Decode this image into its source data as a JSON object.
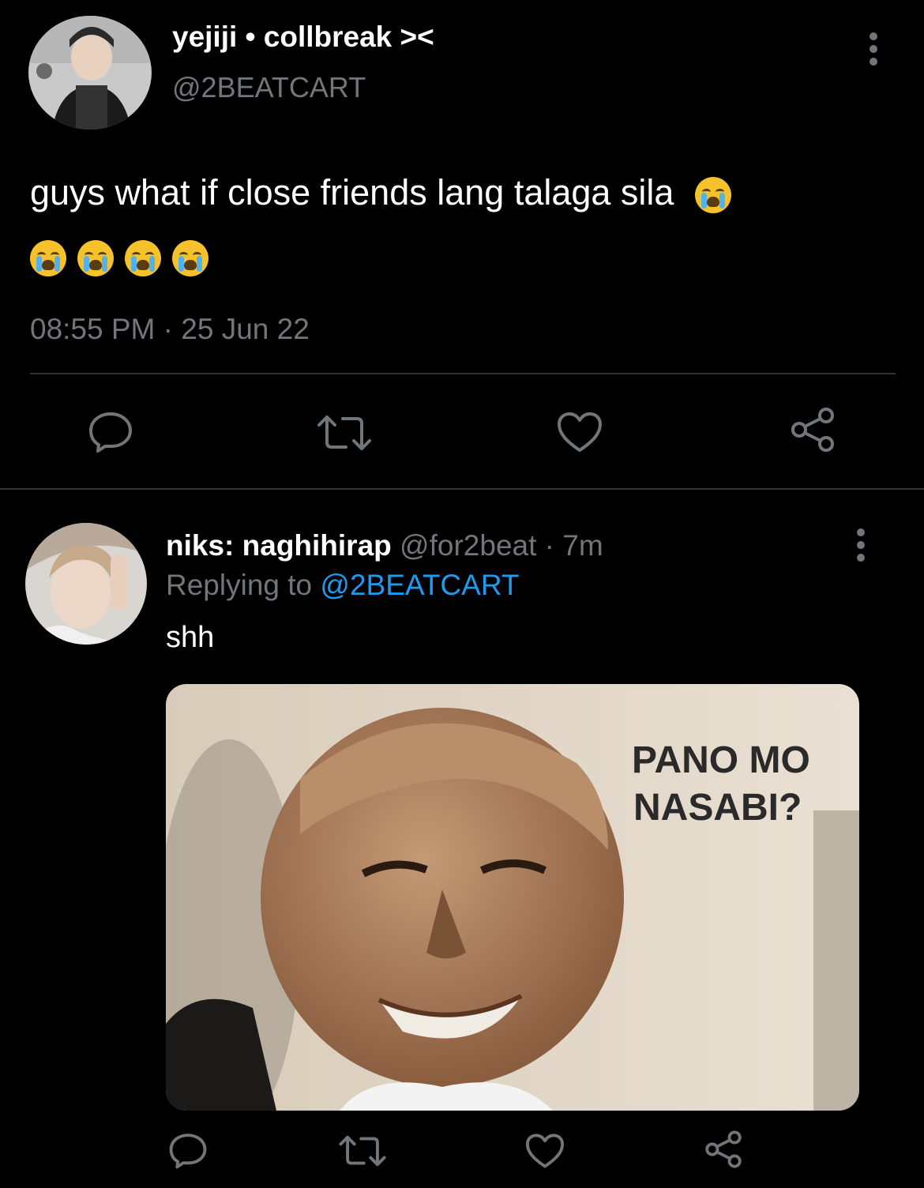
{
  "tweet": {
    "display_name": "yejiji • collbreak ><",
    "handle": "@2BEATCART",
    "text": "guys what if close friends lang talaga sila",
    "emoji_name": "loudly-crying-face",
    "time": "08:55 PM",
    "date": "25 Jun 22",
    "time_date_separator": " · "
  },
  "reply": {
    "display_name": "niks: naghihirap",
    "handle": "@for2beat",
    "age": "7m",
    "age_separator": " · ",
    "replying_to_prefix": "Replying to",
    "replying_to_handle": "@2BEATCART",
    "text": "shh",
    "media_caption_line1": "PANO MO",
    "media_caption_line2": "NASABI?"
  },
  "icons": [
    "more-icon",
    "reply-icon",
    "retweet-icon",
    "like-icon",
    "share-icon"
  ],
  "colors": {
    "background": "#000000",
    "muted_text": "#71767b",
    "link": "#1d9bf0",
    "divider": "#2f3336"
  }
}
